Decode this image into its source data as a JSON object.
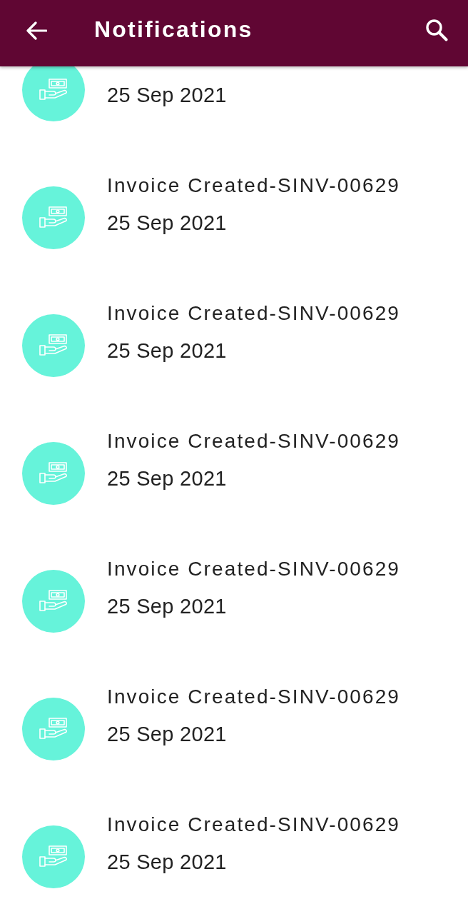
{
  "app_bar": {
    "title": "Notifications"
  },
  "notifications": [
    {
      "date": "25 Sep 2021"
    },
    {
      "title": "Invoice Created-SINV-00629",
      "date": "25 Sep 2021"
    },
    {
      "title": "Invoice Created-SINV-00629",
      "date": "25 Sep 2021"
    },
    {
      "title": "Invoice Created-SINV-00629",
      "date": "25 Sep 2021"
    },
    {
      "title": "Invoice Created-SINV-00629",
      "date": "25 Sep 2021"
    },
    {
      "title": "Invoice Created-SINV-00629",
      "date": "25 Sep 2021"
    },
    {
      "title": "Invoice Created-SINV-00629",
      "date": "25 Sep 2021"
    }
  ]
}
